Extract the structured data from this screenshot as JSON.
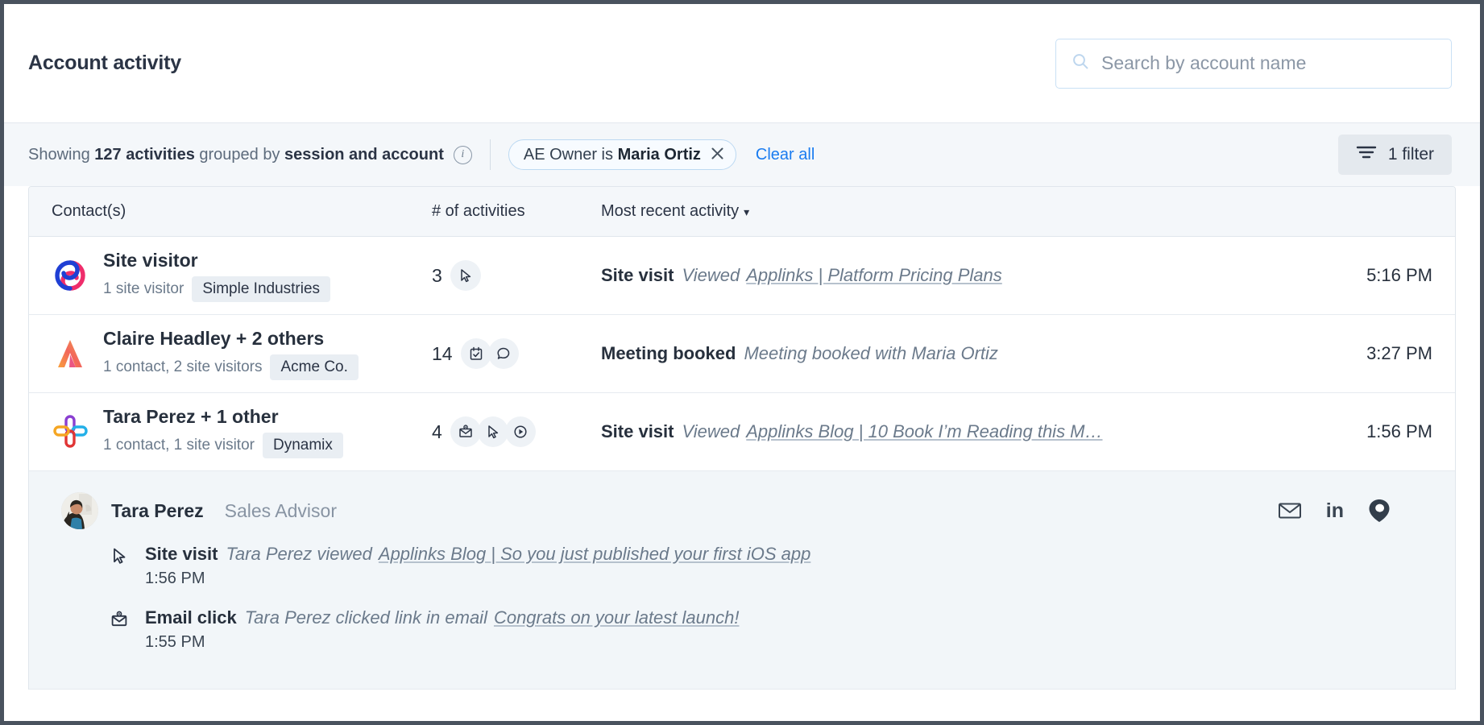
{
  "header": {
    "title": "Account activity",
    "search": {
      "placeholder": "Search by account name",
      "value": "",
      "icon": "search-icon"
    }
  },
  "statusbar": {
    "showing_prefix": "Showing ",
    "count": "127 activities",
    "grouped_prefix": " grouped by ",
    "grouped_by": "session and account",
    "info_icon": "info-icon",
    "filter_chip": {
      "prefix": "AE Owner is ",
      "value": "Maria Ortiz",
      "remove_icon": "close-icon"
    },
    "clear_all": "Clear all",
    "filter_button": {
      "label": "1 filter",
      "icon": "filter-icon"
    }
  },
  "table": {
    "columns": {
      "contacts": "Contact(s)",
      "activities": "# of activities",
      "recent": "Most recent activity",
      "sort_caret": "▾"
    },
    "rows": [
      {
        "logo": "simple-industries-logo",
        "name": "Site visitor",
        "subtitle": "1 site visitor",
        "account": "Simple Industries",
        "count": "3",
        "icons": [
          "cursor-icon"
        ],
        "activity_type": "Site visit",
        "activity_desc": "Viewed",
        "activity_link": "Applinks | Platform Pricing Plans",
        "time": "5:16 PM"
      },
      {
        "logo": "acme-co-logo",
        "name": "Claire Headley + 2 others",
        "subtitle": "1 contact, 2 site visitors",
        "account": "Acme Co.",
        "count": "14",
        "icons": [
          "calendar-check-icon",
          "chat-bubble-icon"
        ],
        "activity_type": "Meeting booked",
        "activity_desc": "Meeting booked with Maria Ortiz",
        "activity_link": "",
        "time": "3:27 PM"
      },
      {
        "logo": "dynamix-logo",
        "name": "Tara Perez + 1 other",
        "subtitle": "1 contact, 1 site visitor",
        "account": "Dynamix",
        "count": "4",
        "icons": [
          "email-click-icon",
          "cursor-icon",
          "play-icon"
        ],
        "activity_type": "Site visit",
        "activity_desc": "Viewed",
        "activity_link": "Applinks Blog | 10 Book I’m Reading this M…",
        "time": "1:56 PM"
      }
    ]
  },
  "expanded": {
    "avatar": "tara-perez-avatar",
    "name": "Tara Perez",
    "role": "Sales Advisor",
    "social": [
      "email-icon",
      "linkedin-icon",
      "crm-pin-icon"
    ],
    "linkedin_label": "in",
    "items": [
      {
        "icon": "cursor-icon",
        "type": "Site visit",
        "desc": "Tara Perez viewed",
        "link": "Applinks Blog | So you just published your first iOS app",
        "time": "1:56 PM"
      },
      {
        "icon": "email-click-icon",
        "type": "Email click",
        "desc": "Tara Perez clicked link in email",
        "link": "Congrats on your latest launch!",
        "time": "1:55 PM"
      }
    ]
  },
  "colors": {
    "accent_blue": "#1a7cf0",
    "text_dark": "#27303d",
    "text_muted": "#6b7a8b",
    "panel_bg": "#f2f6f9",
    "bar_bg": "#f4f7fa"
  }
}
